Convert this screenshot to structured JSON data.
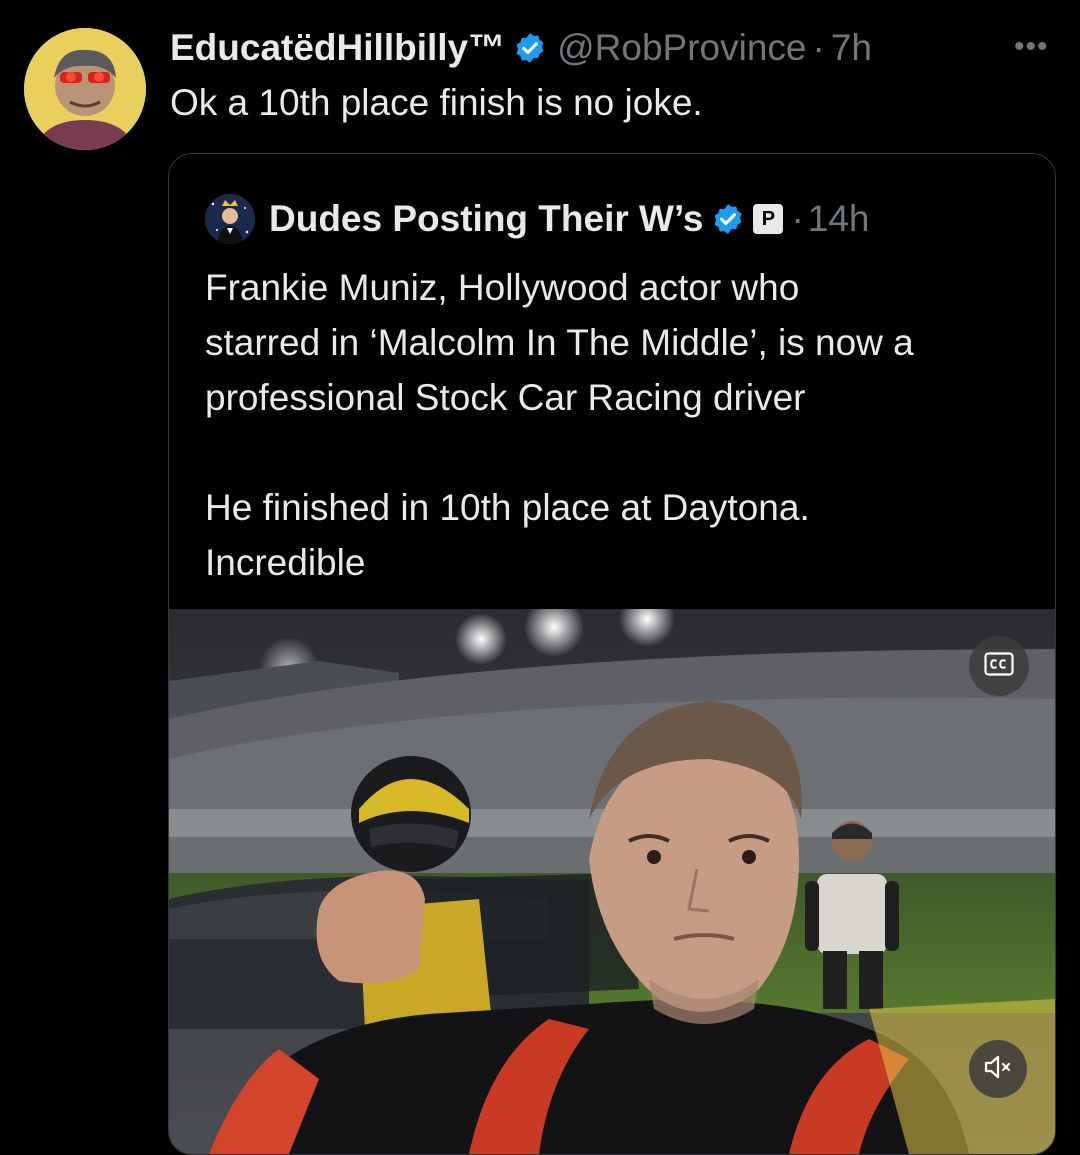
{
  "tweet": {
    "display_name": "EducatëdHillbilly™",
    "handle": "@RobProvince",
    "separator": "·",
    "time": "7h",
    "text": "Ok a 10th place finish is no joke.",
    "more_icon": "more-horizontal-icon",
    "more_label": "•••"
  },
  "quote": {
    "display_name": "Dudes Posting Their W’s",
    "affiliate_badge": "P",
    "separator": "·",
    "time": "14h",
    "text_lines": [
      "Frankie Muniz, Hollywood actor who",
      "starred in ‘Malcolm In The Middle’, is now a",
      "professional Stock Car Racing driver",
      "He finished in 10th place at Daytona.",
      "Incredible"
    ]
  },
  "media": {
    "cc_icon": "closed-captions-icon",
    "mute_icon": "volume-muted-icon"
  },
  "colors": {
    "background": "#000000",
    "text_primary": "#e7e9ea",
    "text_secondary": "#71767b",
    "verified_blue": "#1d9bf0",
    "border": "#333639"
  }
}
